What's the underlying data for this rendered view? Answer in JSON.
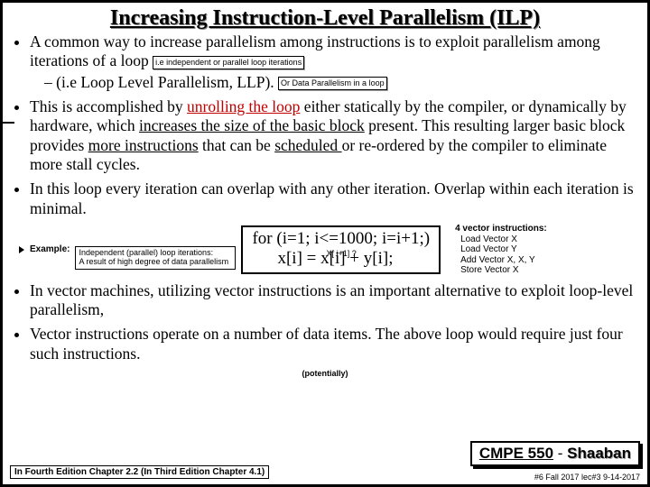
{
  "title": "Increasing Instruction-Level Parallelism (ILP)",
  "bullets": {
    "b1_pre": "A common way to increase parallelism among instructions is to exploit parallelism among iterations of a loop",
    "b1_note1": "i.e independent or parallel loop iterations",
    "b1_sub": "(i.e  Loop Level Parallelism, LLP).",
    "b1_note2": "Or Data Parallelism in a loop",
    "b2_a": "This is accomplished by ",
    "b2_link": "unrolling the loop",
    "b2_b": " either statically by the compiler, or dynamically by hardware, which ",
    "b2_u1": "increases the size of the basic block",
    "b2_c": " present.  This resulting larger basic block provides ",
    "b2_u2": "more instructions",
    "b2_d": " that can be ",
    "b2_u3": "scheduled ",
    "b2_e": "or re-ordered by the compiler to eliminate more stall cycles.",
    "b3": "In this loop every iteration can overlap with any other iteration. Overlap within each iteration is minimal.",
    "b4": "In vector machines, utilizing vector instructions is an important alternative to exploit loop-level parallelism,",
    "b5": "Vector instructions operate on a number of data items.  The above loop would require just four such instructions."
  },
  "example": {
    "label": "Example:",
    "line1": "for (i=1; i<=1000; i=i+1;)",
    "hint": "X[ i+1] ?",
    "line2": "x[i] = x[i] + y[i];",
    "arrow_to_line2": true
  },
  "indep": {
    "l1": "Independent (parallel) loop iterations:",
    "l2": "A result of high degree of data parallelism"
  },
  "vector": {
    "head": "4 vector instructions:",
    "i1": "Load Vector X",
    "i2": "Load Vector Y",
    "i3": "Add Vector X, X, Y",
    "i4": "Store Vector X"
  },
  "potentially": "(potentially)",
  "course": {
    "code": "CMPE 550",
    "dash": " - ",
    "name": "Shaaban"
  },
  "foot_left": "In Fourth Edition Chapter 2.2 (In Third Edition Chapter 4.1)",
  "foot_right": "#6  Fall 2017   lec#3  9-14-2017"
}
